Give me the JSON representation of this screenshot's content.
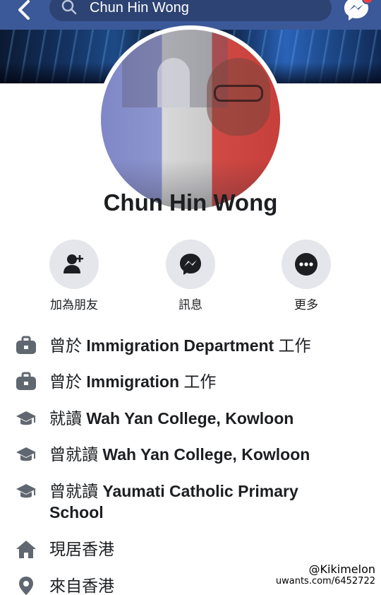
{
  "header": {
    "search_query": "Chun Hin Wong",
    "colors": {
      "bar": "#3b5998",
      "search_bg": "#2d4373",
      "badge": "#fa3e3e"
    }
  },
  "profile": {
    "name": "Chun Hin Wong"
  },
  "actions": [
    {
      "label": "加為朋友",
      "icon": "add-friend-icon"
    },
    {
      "label": "訊息",
      "icon": "messenger-icon"
    },
    {
      "label": "更多",
      "icon": "more-icon"
    }
  ],
  "info": [
    {
      "icon": "briefcase-icon",
      "prefix": "曾於",
      "bold": "Immigration Department",
      "suffix": "工作"
    },
    {
      "icon": "briefcase-icon",
      "prefix": "曾於",
      "bold": "Immigration",
      "suffix": "工作"
    },
    {
      "icon": "graduation-cap-icon",
      "prefix": "就讀",
      "bold": "Wah Yan College, Kowloon",
      "suffix": ""
    },
    {
      "icon": "graduation-cap-icon",
      "prefix": "曾就讀",
      "bold": "Wah Yan College, Kowloon",
      "suffix": ""
    },
    {
      "icon": "graduation-cap-icon",
      "prefix": "曾就讀",
      "bold": "Yaumati Catholic Primary School",
      "suffix": ""
    },
    {
      "icon": "home-icon",
      "prefix": "現居香港",
      "bold": "",
      "suffix": ""
    },
    {
      "icon": "location-pin-icon",
      "prefix": "來自香港",
      "bold": "",
      "suffix": ""
    }
  ],
  "watermark": {
    "handle": "@Kikimelon",
    "url": "uwants.com/6452722"
  }
}
